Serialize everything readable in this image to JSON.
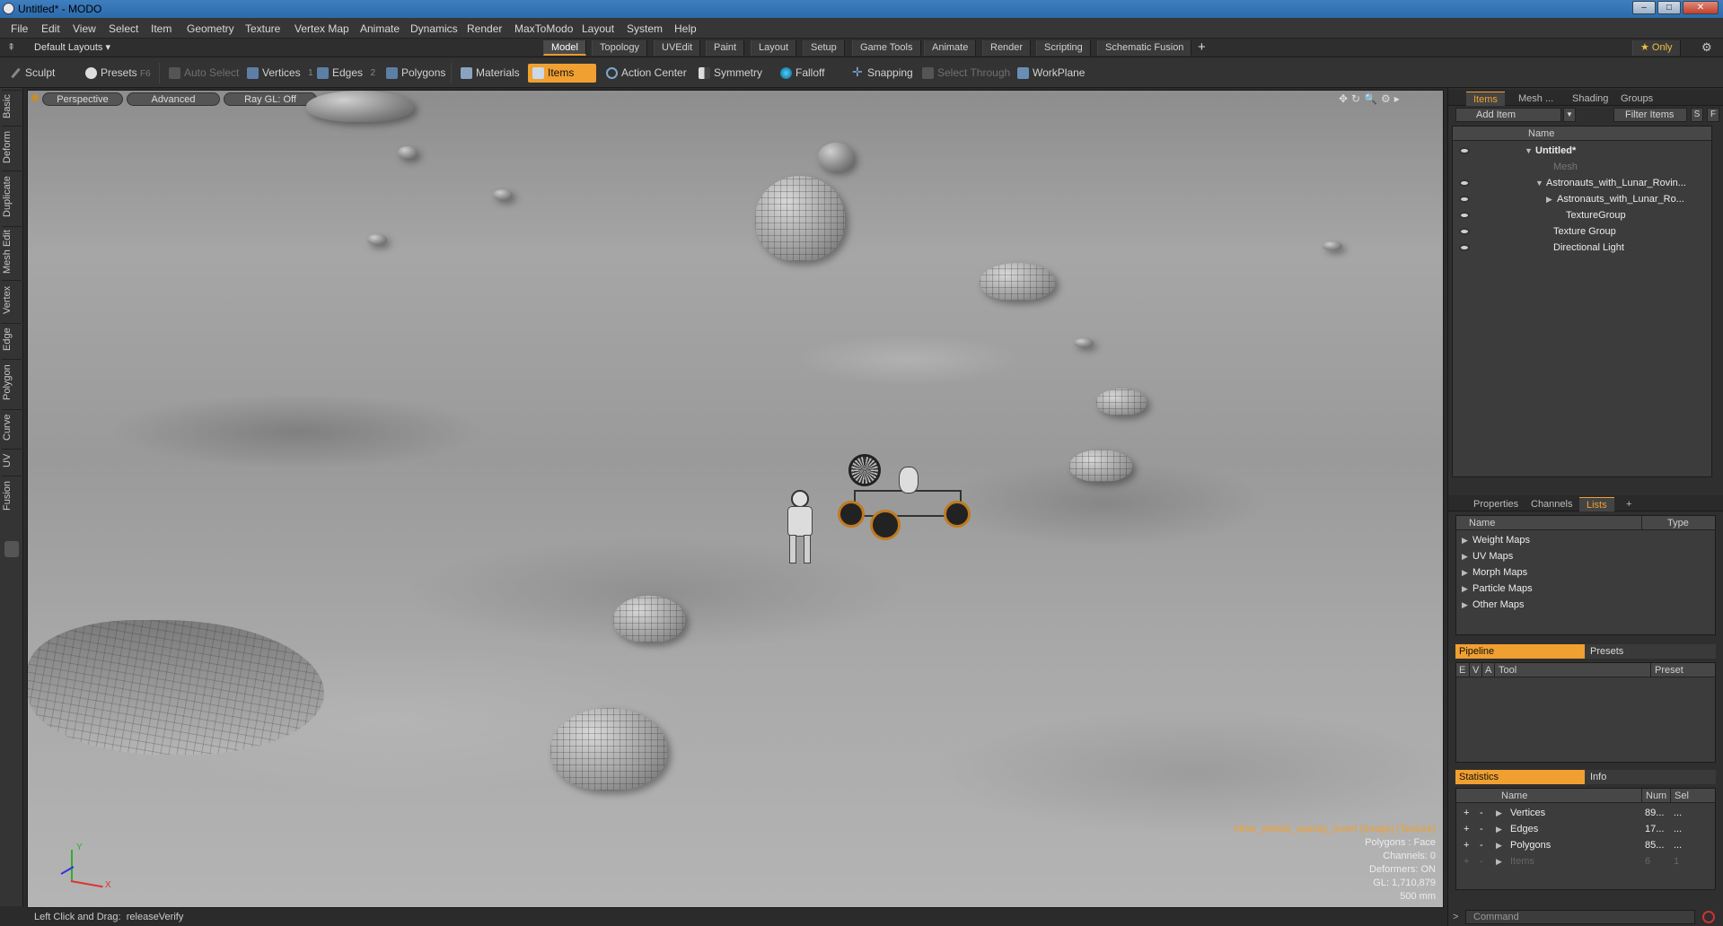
{
  "window": {
    "title": "Untitled* - MODO"
  },
  "menu": [
    "File",
    "Edit",
    "View",
    "Select",
    "Item",
    "Geometry",
    "Texture",
    "Vertex Map",
    "Animate",
    "Dynamics",
    "Render",
    "MaxToModo",
    "Layout",
    "System",
    "Help"
  ],
  "layout_selector": "Default Layouts ▾",
  "layout_tabs": [
    "Model",
    "Topology",
    "UVEdit",
    "Paint",
    "Layout",
    "Setup",
    "Game Tools",
    "Animate",
    "Render",
    "Scripting",
    "Schematic Fusion"
  ],
  "layout_add": "+",
  "only_label": "★ Only",
  "toolbar": {
    "sculpt": "Sculpt",
    "presets": "Presets",
    "presets_key": "F6",
    "auto_select": "Auto Select",
    "vertices": "Vertices",
    "vertices_num": "1",
    "edges": "Edges",
    "edges_num": "2",
    "polygons": "Polygons",
    "materials": "Materials",
    "items": "Items",
    "action_center": "Action Center",
    "symmetry": "Symmetry",
    "falloff": "Falloff",
    "snapping": "Snapping",
    "select_through": "Select Through",
    "workplane": "WorkPlane"
  },
  "left_tabs": [
    "Basic",
    "Deform",
    "Duplicate",
    "Mesh Edit",
    "Vertex",
    "Edge",
    "Polygon",
    "Curve",
    "UV",
    "Fusion"
  ],
  "viewport": {
    "perspective": "Perspective",
    "advanced": "Advanced",
    "raygl": "Ray GL: Off",
    "info": {
      "texture": "other_details_opacity_invert (Image) (Texture)",
      "polygons": "Polygons : Face",
      "channels": "Channels: 0",
      "deformers": "Deformers: ON",
      "gl": "GL: 1,710,879",
      "scale": "500 mm"
    },
    "axis_x": "X",
    "axis_y": "Y"
  },
  "items_panel": {
    "tabs": [
      "Items",
      "Mesh ...",
      "Shading",
      "Groups"
    ],
    "add_item": "Add Item",
    "filter_items": "Filter Items",
    "s_btn": "S",
    "f_btn": "F",
    "col_name": "Name",
    "rows": [
      {
        "label": "Untitled*"
      },
      {
        "label": "Mesh"
      },
      {
        "label": "Astronauts_with_Lunar_Rovin..."
      },
      {
        "label": "Astronauts_with_Lunar_Ro..."
      },
      {
        "label": "TextureGroup"
      },
      {
        "label": "Texture Group"
      },
      {
        "label": "Directional Light"
      }
    ]
  },
  "lists_panel": {
    "tabs": [
      "Properties",
      "Channels",
      "Lists",
      "+"
    ],
    "col_name": "Name",
    "col_type": "Type",
    "rows": [
      "Weight Maps",
      "UV Maps",
      "Morph Maps",
      "Particle Maps",
      "Other Maps"
    ]
  },
  "pipeline_panel": {
    "tab_pipeline": "Pipeline",
    "tab_presets": "Presets",
    "col_e": "E",
    "col_v": "V",
    "col_a": "A",
    "col_tool": "Tool",
    "col_preset": "Preset"
  },
  "stats_panel": {
    "tab_statistics": "Statistics",
    "tab_info": "Info",
    "col_name": "Name",
    "col_num": "Num",
    "col_sel": "Sel",
    "rows": [
      {
        "name": "Vertices",
        "num": "89...",
        "sel": "..."
      },
      {
        "name": "Edges",
        "num": "17...",
        "sel": "..."
      },
      {
        "name": "Polygons",
        "num": "85...",
        "sel": "..."
      },
      {
        "name": "Items",
        "num": "6",
        "sel": "1"
      }
    ]
  },
  "status": {
    "label": "Left Click and Drag:",
    "value": "releaseVerify"
  },
  "command": {
    "placeholder": "Command"
  }
}
